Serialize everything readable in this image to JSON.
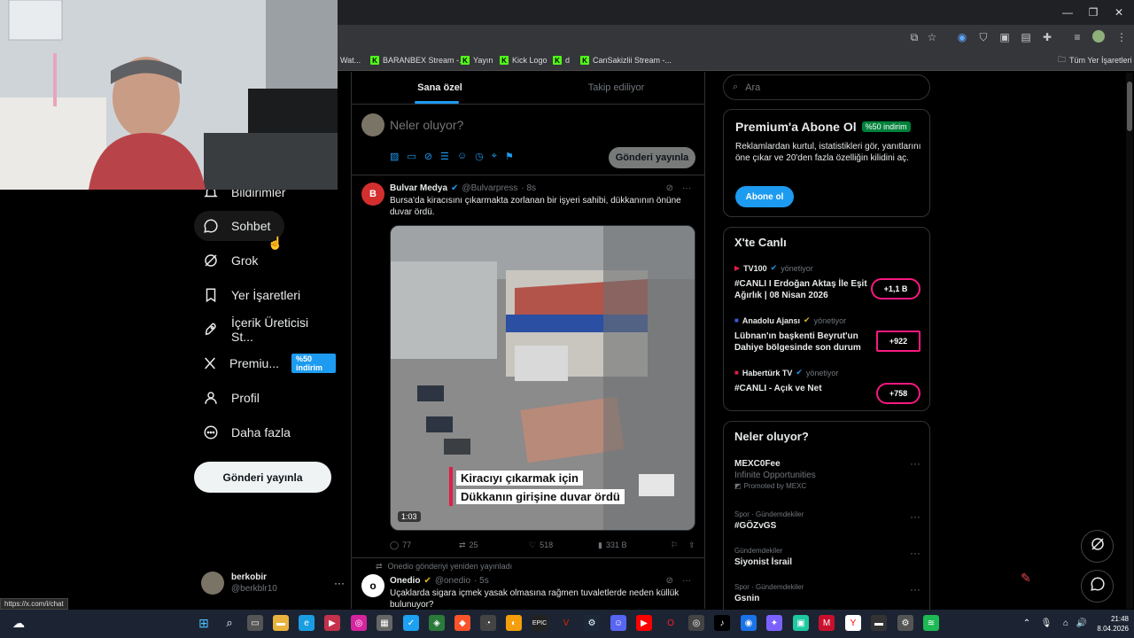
{
  "browser": {
    "bookmarks": [
      {
        "label": "Wat..."
      },
      {
        "label": "BARANBEX Stream -..."
      },
      {
        "label": "Yayın"
      },
      {
        "label": "Kick Logo"
      },
      {
        "label": "d"
      },
      {
        "label": "CanSakizlii Stream -..."
      }
    ],
    "all_bookmarks": "Tüm Yer İşaretleri"
  },
  "sidebar": {
    "items": [
      {
        "label": "Bildirimler"
      },
      {
        "label": "Sohbet"
      },
      {
        "label": "Grok"
      },
      {
        "label": "Yer İşaretleri"
      },
      {
        "label": "İçerik Üreticisi St..."
      },
      {
        "label": "Premiu..."
      },
      {
        "label": "Profil"
      },
      {
        "label": "Daha fazla"
      }
    ],
    "premium_badge": "%50 indirim",
    "post_button": "Gönderi yayınla",
    "user": {
      "name": "berkobir",
      "handle": "@berkblr10"
    }
  },
  "timeline": {
    "tabs": [
      {
        "label": "Sana özel"
      },
      {
        "label": "Takip ediliyor"
      }
    ],
    "composer": {
      "placeholder": "Neler oluyor?",
      "post_button": "Gönderi yayınla"
    },
    "post1": {
      "author": "Bulvar Medya",
      "handle": "@Bulvarpress",
      "time": "· 8s",
      "text": "Bursa'da kiracısını çıkarmakta zorlanan bir işyeri sahibi, dükkanının önüne duvar ördü.",
      "video_caption_1": "Kiracıyı çıkarmak için",
      "video_caption_2": "Dükkanın girişine duvar ördü",
      "duration": "1:03",
      "replies": "77",
      "reposts": "25",
      "likes": "518",
      "views": "331 B"
    },
    "post2": {
      "repost_note": "Onedio gönderiyi yeniden yayınladı",
      "author": "Onedio",
      "handle": "@onedio",
      "time": "· 5s",
      "text": "Uçaklarda sigara içmek yasak olmasına rağmen tuvaletlerde neden küllük bulunuyor?"
    }
  },
  "right": {
    "search_placeholder": "Ara",
    "premium": {
      "title": "Premium'a Abone Ol",
      "badge": "%50 indirim",
      "text": "Reklamlardan kurtul, istatistikleri gör, yanıtlarını öne çıkar ve 20'den fazla özelliğin kilidini aç.",
      "button": "Abone ol"
    },
    "live": {
      "title": "X'te Canlı",
      "items": [
        {
          "host": "TV100",
          "role": "yönetiyor",
          "title": "#CANLI I Erdoğan Aktaş İle Eşit Ağırlık | 08 Nisan 2026",
          "count": "+1,1 B"
        },
        {
          "host": "Anadolu Ajansı",
          "role": "yönetiyor",
          "title": "Lübnan'ın başkenti Beyrut'un Dahiye bölgesinde son durum",
          "count": "+922"
        },
        {
          "host": "Habertürk TV",
          "role": "yönetiyor",
          "title": "#CANLI - Açık ve Net",
          "count": "+758"
        }
      ]
    },
    "trends": {
      "title": "Neler oluyor?",
      "items": [
        {
          "meta": "",
          "name": "MEXC0Fee",
          "sub": "Infinite Opportunities",
          "promo": "Promoted by MEXC"
        },
        {
          "meta": "Spor · Gündemdekiler",
          "name": "#GÖZvGS",
          "sub": "",
          "promo": ""
        },
        {
          "meta": "Gündemdekiler",
          "name": "Siyonist İsrail",
          "sub": "",
          "promo": ""
        },
        {
          "meta": "Spor · Gündemdekiler",
          "name": "Gsnin",
          "sub": "",
          "promo": ""
        }
      ]
    }
  },
  "status_url": "https://x.com/i/chat",
  "taskbar": {
    "time": "21:48",
    "date": "8.04.2026"
  }
}
